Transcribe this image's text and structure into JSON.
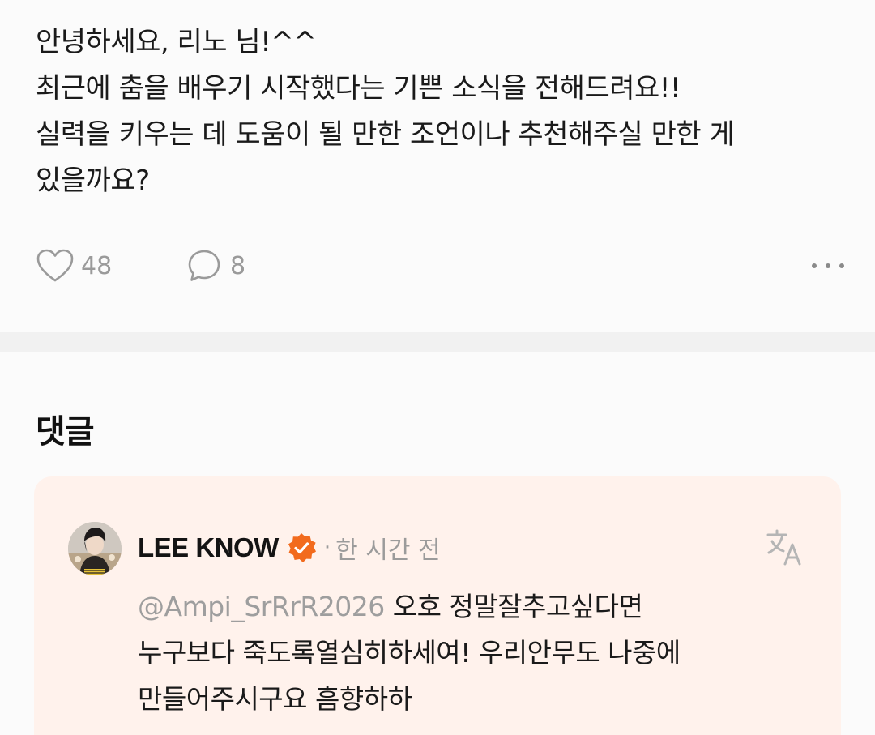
{
  "post": {
    "lines": [
      "안녕하세요, 리노 님!^^",
      "최근에 춤을 배우기 시작했다는 기쁜 소식을 전해드려요!!",
      "실력을 키우는 데 도움이 될 만한 조언이나 추천해주실 만한 게",
      "있을까요?"
    ],
    "like_count": "48",
    "comment_count": "8"
  },
  "comments": {
    "heading": "댓글",
    "items": [
      {
        "author": "LEE KNOW",
        "separator": "·",
        "time": "한 시간 전",
        "mention": "@Ampi_SrRrR2026",
        "lines": [
          " 오호 정말잘추고싶다면",
          "누구보다 죽도록열심히하세여! 우리안무도 나중에",
          "만들어주시구요 흠향하하"
        ]
      }
    ]
  },
  "colors": {
    "background": "#fbfbfb",
    "card_background": "#fff2ec",
    "verified_badge": "#f26b1d",
    "muted_text": "#9b9b9b"
  },
  "icons": [
    "heart-icon",
    "comment-bubble-icon",
    "more-icon",
    "verified-badge-icon",
    "translate-icon"
  ]
}
